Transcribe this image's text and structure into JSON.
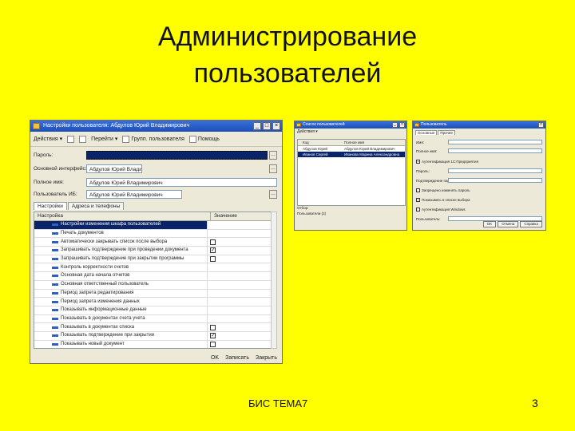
{
  "slide": {
    "title_line1": "Администрирование",
    "title_line2": "пользователей",
    "footer": "БИС ТЕМА7",
    "page_number": "3",
    "background": "#ffff00"
  },
  "main_window": {
    "title": "Настройки пользователя: Абдулов Юрий Владимирович",
    "controls": {
      "minimize": "_",
      "maximize": "□",
      "close": "×"
    },
    "toolbar": {
      "actions": "Действия ▾",
      "go": "Перейти ▾",
      "group": "Групп. пользователя",
      "help": "Помощь"
    },
    "fields": [
      {
        "label": "Пароль:",
        "value": ""
      },
      {
        "label": "Основной интерфейс:",
        "value": "Абдулов Юрий Владимирович"
      },
      {
        "label": "Полное имя:",
        "value": "Абдулов Юрий Владимирович"
      },
      {
        "label": "Пользователь ИБ:",
        "value": "Абдулов Юрий Владимирович"
      }
    ],
    "tabs": [
      "Настройки",
      "Адреса и телефоны"
    ],
    "grid": {
      "headers": [
        "Настройка",
        "Значение"
      ],
      "rows": [
        {
          "label": "Настройки изменения шкафа пользователей",
          "checked": false,
          "highlight": true
        },
        {
          "label": "Печать документов",
          "checked": false,
          "highlight": false
        },
        {
          "label": "Автоматически закрывать список после выбора",
          "checked": false,
          "highlight": false
        },
        {
          "label": "Запрашивать подтверждение при проведении документа",
          "checked": true,
          "highlight": false
        },
        {
          "label": "Запрашивать подтверждение при закрытии программы",
          "checked": false,
          "highlight": false
        },
        {
          "label": "Контроль корректности счетов",
          "checked": false,
          "highlight": false
        },
        {
          "label": "Основная дата начала отчетов",
          "checked": false,
          "highlight": false
        },
        {
          "label": "Основная ответственный пользователь",
          "checked": false,
          "highlight": false
        },
        {
          "label": "Период запрета редактирования",
          "checked": false,
          "highlight": false
        },
        {
          "label": "Период запрета изменения данных",
          "checked": false,
          "highlight": false
        },
        {
          "label": "Показывать информационные данные",
          "checked": false,
          "highlight": false
        },
        {
          "label": "Показывать в документах счета учета",
          "checked": false,
          "highlight": false
        },
        {
          "label": "Показывать в документах списка",
          "checked": false,
          "highlight": false
        },
        {
          "label": "Показывать подтверждение при закрытии",
          "checked": true,
          "highlight": false
        },
        {
          "label": "Показывать новый документ",
          "checked": false,
          "highlight": false
        }
      ]
    },
    "buttons": {
      "ok": "OK",
      "save": "Записать",
      "close": "Закрыть"
    }
  },
  "list_window": {
    "title": "Список пользователей",
    "toolbar": "Действия ▾",
    "headers": [
      "Код",
      "Полное имя"
    ],
    "rows": [
      {
        "code": "Абдулов Юрий",
        "name": "Абдулов Юрий Владимирович",
        "highlight": false
      },
      {
        "code": "Иванов Сергей",
        "name": "Иванова Марина Александровна",
        "highlight": true
      }
    ],
    "footer_label": "Отбор:",
    "footer_value": "Пользователи (2)"
  },
  "user_dialog": {
    "title": "Пользователь",
    "tabs": [
      "Основные",
      "Прочее"
    ],
    "fields": [
      {
        "label": "Имя:",
        "type": "input",
        "checked": false
      },
      {
        "label": "Полное имя:",
        "type": "input",
        "checked": false
      },
      {
        "label": "Аутентификация 1С:Предприятия",
        "type": "check",
        "checked": true
      },
      {
        "label": "Пароль:",
        "type": "input",
        "checked": false
      },
      {
        "label": "Подтверждение пароля:",
        "type": "input",
        "checked": false
      },
      {
        "label": "Запрещено изменять пароль",
        "type": "check",
        "checked": false
      },
      {
        "label": "Показывать в списке выбора",
        "type": "check",
        "checked": true
      },
      {
        "label": "Аутентификация Windows",
        "type": "check",
        "checked": false
      },
      {
        "label": "Пользователь:",
        "type": "input",
        "checked": false
      }
    ],
    "buttons": {
      "ok": "OK",
      "cancel": "Отмена",
      "help": "Справка"
    }
  }
}
